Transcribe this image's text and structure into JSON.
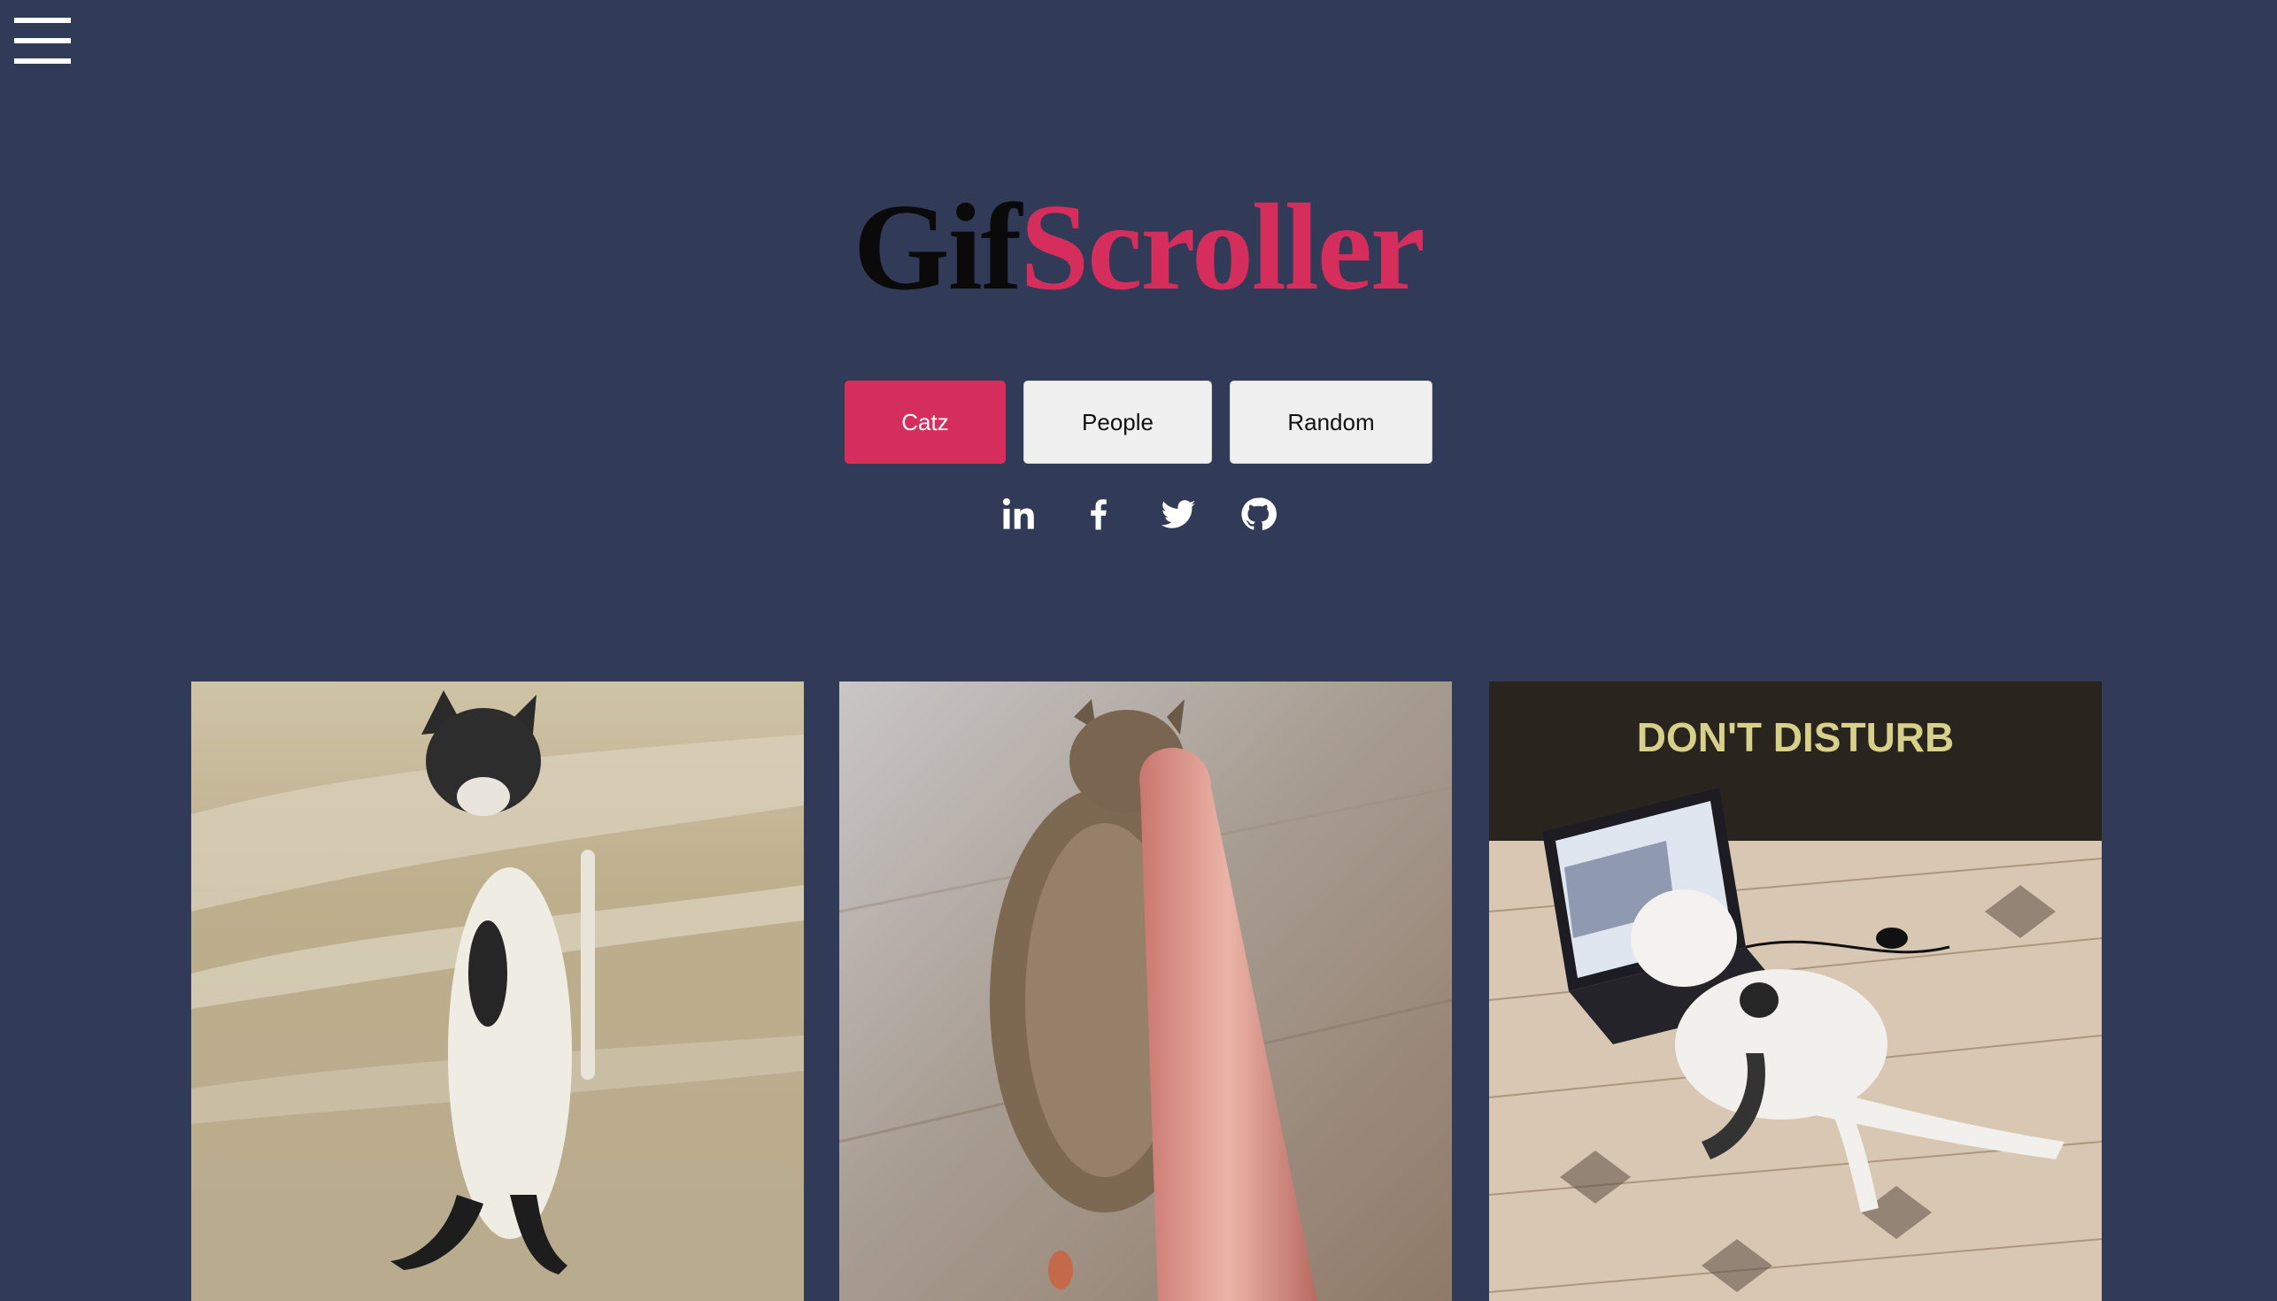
{
  "header": {
    "menu_icon": "hamburger-menu-icon",
    "title_part_1": "Gif",
    "title_part_2": "Scroller"
  },
  "categories": [
    {
      "label": "Catz",
      "active": true
    },
    {
      "label": "People",
      "active": false
    },
    {
      "label": "Random",
      "active": false
    }
  ],
  "social_links": [
    {
      "icon": "linkedin-icon"
    },
    {
      "icon": "facebook-icon"
    },
    {
      "icon": "twitter-icon"
    },
    {
      "icon": "github-icon"
    }
  ],
  "gifs": [
    {
      "subject": "black-and-white cat standing upright on a beach"
    },
    {
      "subject": "tabby cat lying on wooden floor hugging a sausage"
    },
    {
      "subject": "white cat with laptop on patterned rug",
      "caption": "DON'T DISTURB"
    }
  ],
  "colors": {
    "background": "#313a56",
    "accent": "#d62e5c",
    "button_inactive": "#f0f0f0",
    "title_dark": "#0a0a0a",
    "caption_text": "#d6d08a"
  }
}
